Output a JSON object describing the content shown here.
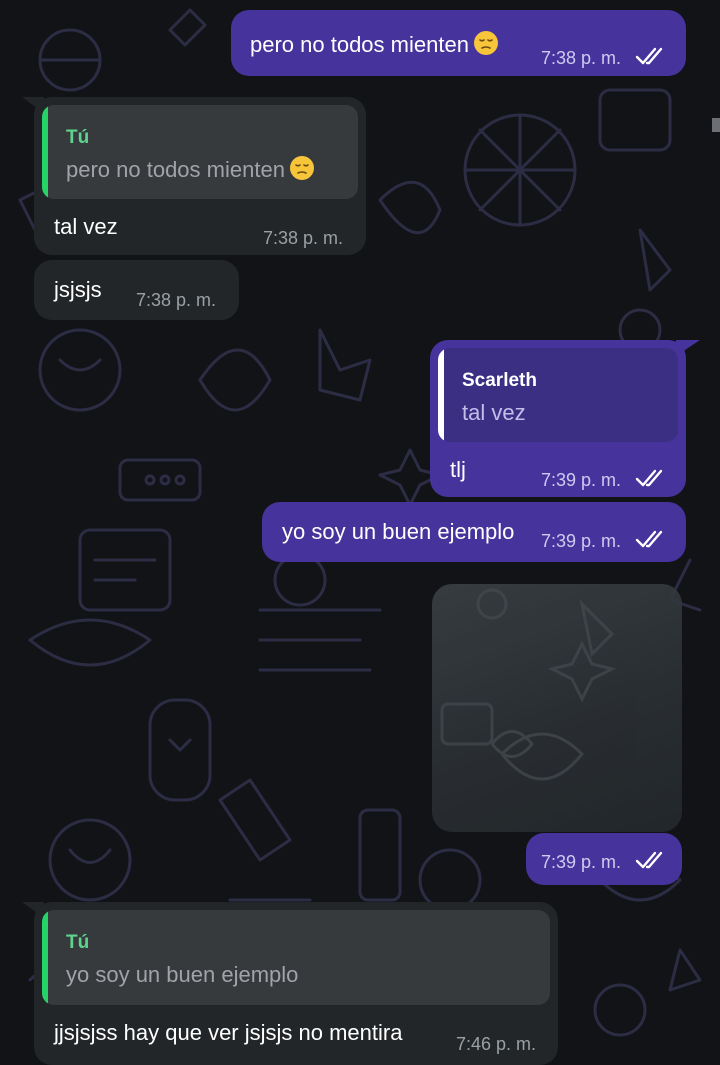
{
  "colors": {
    "outgoing_bubble": "#46349c",
    "incoming_bubble": "#232628",
    "quote_author_green": "#5fd38d",
    "quote_bar_green": "#25d366",
    "quote_bar_white": "#ffffff",
    "ticks": "#ffffff"
  },
  "messages": {
    "m1": {
      "text": "pero no todos mienten",
      "emoji": "pensive-face-emoji",
      "time": "7:38 p. m."
    },
    "m2": {
      "quote_author": "Tú",
      "quote_text": "pero no todos mienten",
      "quote_emoji": "pensive-face-emoji",
      "text": "tal vez",
      "time": "7:38 p. m."
    },
    "m3": {
      "text": "jsjsjs",
      "time": "7:38 p. m."
    },
    "m4": {
      "quote_author": "Scarleth",
      "quote_text": "tal vez",
      "text": "tlj",
      "time": "7:39 p. m."
    },
    "m5": {
      "text": "yo soy un buen ejemplo",
      "time": "7:39 p. m."
    },
    "m6": {
      "media": "blurred-image",
      "time": "7:39 p. m."
    },
    "m7": {
      "quote_author": "Tú",
      "quote_text": "yo soy un buen ejemplo",
      "text": "jjsjsjss hay que ver jsjsjs no mentira",
      "time": "7:46 p. m."
    }
  }
}
